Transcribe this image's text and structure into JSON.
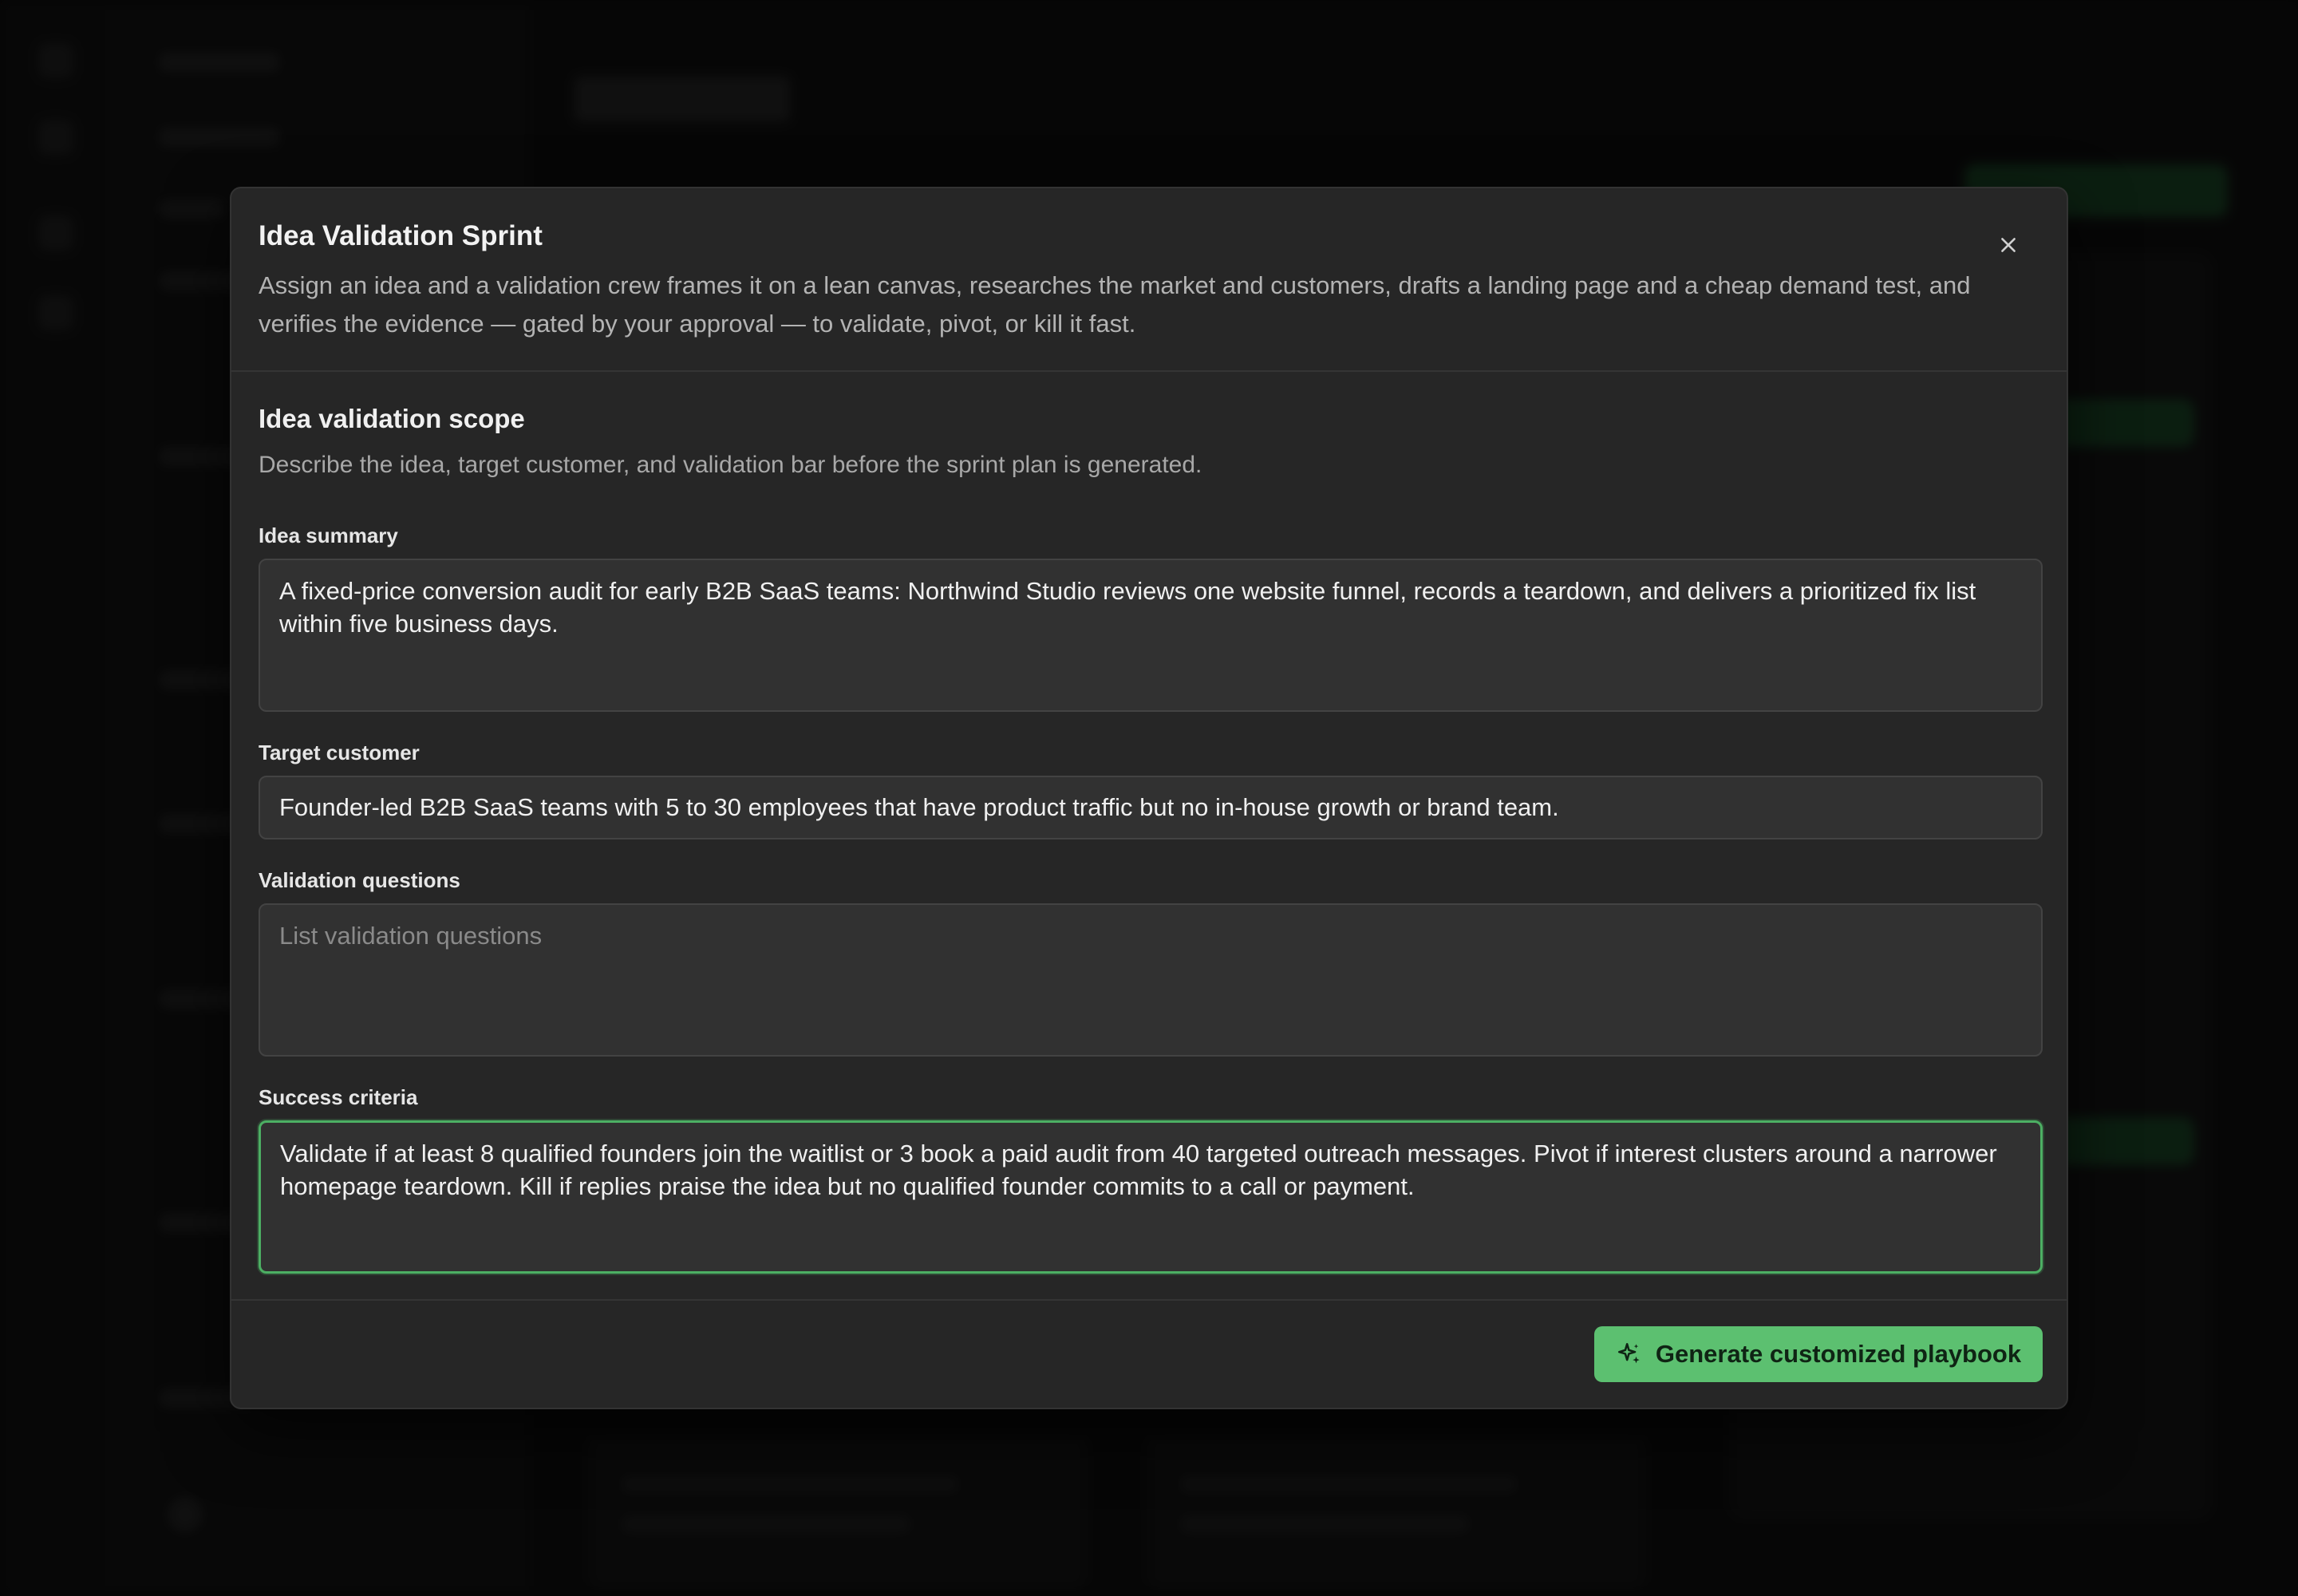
{
  "modal": {
    "title": "Idea Validation Sprint",
    "description": "Assign an idea and a validation crew frames it on a lean canvas, researches the market and customers, drafts a landing page and a cheap demand test, and verifies the evidence — gated by your approval — to validate, pivot, or kill it fast.",
    "close_icon": "close-icon"
  },
  "scope": {
    "title": "Idea validation scope",
    "description": "Describe the idea, target customer, and validation bar before the sprint plan is generated."
  },
  "fields": {
    "idea_summary": {
      "label": "Idea summary",
      "value": "A fixed-price conversion audit for early B2B SaaS teams: Northwind Studio reviews one website funnel, records a teardown, and delivers a prioritized fix list within five business days."
    },
    "target_customer": {
      "label": "Target customer",
      "value": "Founder-led B2B SaaS teams with 5 to 30 employees that have product traffic but no in-house growth or brand team."
    },
    "validation_questions": {
      "label": "Validation questions",
      "value": "",
      "placeholder": "List validation questions"
    },
    "success_criteria": {
      "label": "Success criteria",
      "value": "Validate if at least 8 qualified founders join the waitlist or 3 book a paid audit from 40 targeted outreach messages. Pivot if interest clusters around a narrower homepage teardown. Kill if replies praise the idea but no qualified founder commits to a call or payment."
    }
  },
  "footer": {
    "generate_label": "Generate customized playbook",
    "generate_icon": "sparkles-icon"
  },
  "colors": {
    "accent": "#5cc070",
    "focus_border": "#4caf63",
    "modal_bg": "#262626",
    "field_bg": "#313131"
  }
}
